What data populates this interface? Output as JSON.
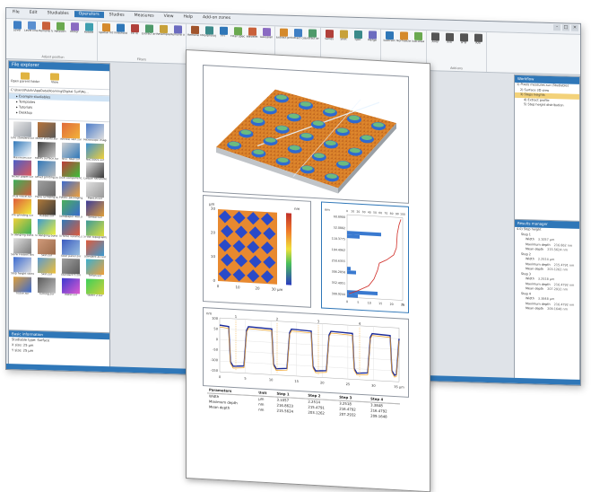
{
  "window": {
    "tabs": [
      "File",
      "Edit",
      "Studiables",
      "Operators",
      "Studies",
      "Measures",
      "View",
      "Help",
      "Add-on zones"
    ],
    "active_tab": "Operators"
  },
  "ribbon": {
    "groups": [
      {
        "label": "Adjust position",
        "buttons": [
          {
            "label": "Level",
            "color": "#3f7fc4"
          },
          {
            "label": "Level line-by-line",
            "color": "#5a8fd0"
          },
          {
            "label": "Remove form",
            "color": "#c9603a"
          },
          {
            "label": "Retouch",
            "color": "#6aa94f"
          },
          {
            "label": "Mirror",
            "color": "#8a6bc2"
          },
          {
            "label": "Rotate",
            "color": "#3f9fb0"
          }
        ]
      },
      {
        "label": "Filters",
        "buttons": [
          {
            "label": "Spatial filter",
            "color": "#d58a2c"
          },
          {
            "label": "Threshold",
            "color": "#2f77b8"
          },
          {
            "label": "Fill in",
            "color": "#b0403a"
          },
          {
            "label": "Extract area",
            "color": "#4e9a6a"
          },
          {
            "label": "Resample",
            "color": "#c7a13a"
          },
          {
            "label": "Remove outliers",
            "color": "#6c6cc0"
          }
        ]
      },
      {
        "label": "Filter",
        "buttons": [
          {
            "label": "Remove noise",
            "color": "#a0542c"
          },
          {
            "label": "Morphologic",
            "color": "#3a8a8a"
          },
          {
            "label": "FFT",
            "color": "#2f77b8"
          },
          {
            "label": "Filter spectrum",
            "color": "#6aa94f"
          },
          {
            "label": "Wavelet",
            "color": "#c9603a"
          },
          {
            "label": "Gaussian",
            "color": "#8a6bc2"
          }
        ]
      },
      {
        "label": "Extract",
        "buttons": [
          {
            "label": "Extract profile",
            "color": "#d58a2c"
          },
          {
            "label": "Extract contour",
            "color": "#3f7fc4"
          },
          {
            "label": "Extract area",
            "color": "#4e9a6a"
          }
        ]
      },
      {
        "label": "Combine",
        "buttons": [
          {
            "label": "Series",
            "color": "#b0403a"
          },
          {
            "label": "Shift",
            "color": "#c7a13a"
          },
          {
            "label": "Split",
            "color": "#3a8a8a"
          },
          {
            "label": "Merge",
            "color": "#6c6cc0"
          }
        ]
      },
      {
        "label": "Studies",
        "buttons": [
          {
            "label": "Subtract",
            "color": "#2f77b8"
          },
          {
            "label": "Normalize",
            "color": "#d58a2c"
          },
          {
            "label": "Sub-area",
            "color": "#6aa94f"
          }
        ]
      },
      {
        "label": "Add-ons",
        "buttons": [
          {
            "label": "A+B",
            "color": "#555555"
          },
          {
            "label": "A-B",
            "color": "#555555"
          },
          {
            "label": "A*B",
            "color": "#555555"
          },
          {
            "label": "A/B",
            "color": "#555555"
          }
        ]
      }
    ]
  },
  "left_panel": {
    "title": "File explorer",
    "toolbar": [
      {
        "label": "Open parent folder"
      },
      {
        "label": "View"
      }
    ],
    "path": "C:\\Users\\Public\\AppData\\Roaming\\Digital Surf\\Mo...",
    "tree": [
      "Example studiables",
      "Templates",
      "Tutorials",
      "Desktop"
    ],
    "tree_selected": 0,
    "thumbnails": [
      {
        "label": "Line standard.sur",
        "a": "#e9e9e9",
        "b": "#9aa0a8"
      },
      {
        "label": "Metal inserts.sur",
        "a": "#b8743a",
        "b": "#5a5a5a"
      },
      {
        "label": "Wrinkle skin.sur",
        "a": "#e06a3a",
        "b": "#f2b33a"
      },
      {
        "label": "Microscope image.sur",
        "a": "#4a7ac8",
        "b": "#e0e0e0"
      },
      {
        "label": "Maximum.sur",
        "a": "#2f77b8",
        "b": "#ffffff"
      },
      {
        "label": "MEMS surface.sur",
        "a": "#3b3b3b",
        "b": "#cfcfcf"
      },
      {
        "label": "NIST fiber.sur",
        "a": "#d0d0d0",
        "b": "#2f77b8"
      },
      {
        "label": "NaCl0001.sur",
        "a": "#3a8fd0",
        "b": "#f0d03a"
      },
      {
        "label": "Nickel paper.sur",
        "a": "#4a5ec8",
        "b": "#e05a5a"
      },
      {
        "label": "Offset printing.sur",
        "a": "#2f77b8",
        "b": "#c0c0c0"
      },
      {
        "label": "Dual component.sur",
        "a": "#c03a3a",
        "b": "#3ac03a"
      },
      {
        "label": "Carbon nanotube.sur",
        "a": "#e0e0e0",
        "b": "#3a3a3a"
      },
      {
        "label": "PCB visual.sur",
        "a": "#3ab05a",
        "b": "#d05a3a"
      },
      {
        "label": "Plane Grinding.sur",
        "a": "#a0a0a0",
        "b": "#6a6a6a"
      },
      {
        "label": "Plastic packaging.sur",
        "a": "#3a6ad0",
        "b": "#f0a03a"
      },
      {
        "label": "PlanLin.sur",
        "a": "#e0e0e0",
        "b": "#9a9a9a"
      },
      {
        "label": "Pre-grinding.sur",
        "a": "#e05a3a",
        "b": "#f0f03a"
      },
      {
        "label": "Rubber.sur",
        "a": "#b07a3a",
        "b": "#3a3a3a"
      },
      {
        "label": "Sandpaper 400.sur",
        "a": "#4ab05a",
        "b": "#3a6ad0"
      },
      {
        "label": "Sensor.sur",
        "a": "#3a3a9a",
        "b": "#e0a03a"
      },
      {
        "label": "Si dangling bond.sur",
        "a": "#f0d03a",
        "b": "#3ab05a"
      },
      {
        "label": "Si dangling bond 2.sur",
        "a": "#3a9ad0",
        "b": "#f0f03a"
      },
      {
        "label": "Si force volume.sur",
        "a": "#2f77b8",
        "b": "#e05a3a"
      },
      {
        "label": "Si-dot topography.sur",
        "a": "#3a9a9a",
        "b": "#e0e03a"
      },
      {
        "label": "Slenk Fresnel lens.sur",
        "a": "#e0e0e0",
        "b": "#7a7a7a"
      },
      {
        "label": "Skin.sur",
        "a": "#d09a7a",
        "b": "#9a6a4a"
      },
      {
        "label": "Solar panel.sur",
        "a": "#3a5ac0",
        "b": "#9ac0e0"
      },
      {
        "label": "Standard 2D.sur",
        "a": "#e05a3a",
        "b": "#3a9ad0"
      },
      {
        "label": "Step height standard.sur",
        "a": "#3a6ad0",
        "b": "#e0e0e0"
      },
      {
        "label": "Skin.sur",
        "a": "#5a9ad0",
        "b": "#f0c03a"
      },
      {
        "label": "Standard 5.sur",
        "a": "#a0a0a0",
        "b": "#5a5a5a"
      },
      {
        "label": "Teflon.sur",
        "a": "#3ab0d0",
        "b": "#f0a03a"
      },
      {
        "label": "Tissue.sur",
        "a": "#e0a03a",
        "b": "#3a6ad0"
      },
      {
        "label": "Turning.sur",
        "a": "#5a5a5a",
        "b": "#c0c0c0"
      },
      {
        "label": "Wafer.sur",
        "a": "#3a3ad0",
        "b": "#e05ad0"
      },
      {
        "label": "Wafer 2.sur",
        "a": "#3ad05a",
        "b": "#d0d03a"
      }
    ],
    "basic_info": {
      "title": "Basic information",
      "lines": [
        "Studiable type: Surface",
        "X size: 25 µm",
        "Y size: 25 µm"
      ]
    }
  },
  "right_panel": {
    "top_title": "Workflow",
    "top_rows": [
      {
        "text": "1) Pixels measures.sur (Studiable)",
        "indent": 2,
        "sel": false
      },
      {
        "text": "2) Surface 3D view",
        "indent": 6,
        "sel": false
      },
      {
        "text": "3) Steps heights",
        "indent": 6,
        "sel": true
      },
      {
        "text": "4) Extract profile",
        "indent": 10,
        "sel": false
      },
      {
        "text": "5) Step height distribution",
        "indent": 10,
        "sel": false
      }
    ],
    "bottom_title": "Results manager",
    "bottom_rows": [
      {
        "text": "4.0) Step height",
        "v": ""
      },
      {
        "text": "Step 1",
        "v": ""
      },
      {
        "text": "Width",
        "v": "3.1057 µm"
      },
      {
        "text": "Maximum depth",
        "v": "216.862 nm"
      },
      {
        "text": "Mean depth",
        "v": "215.5624 nm"
      },
      {
        "text": "Step 2",
        "v": ""
      },
      {
        "text": "Width",
        "v": "2.2514 µm"
      },
      {
        "text": "Maximum depth",
        "v": "215.4791 nm"
      },
      {
        "text": "Mean depth",
        "v": "203.1262 nm"
      },
      {
        "text": "Step 3",
        "v": ""
      },
      {
        "text": "Width",
        "v": "3.2518 µm"
      },
      {
        "text": "Maximum depth",
        "v": "216.4792 nm"
      },
      {
        "text": "Mean depth",
        "v": "207.2932 nm"
      },
      {
        "text": "Step 4",
        "v": ""
      },
      {
        "text": "Width",
        "v": "3.3848 µm"
      },
      {
        "text": "Maximum depth",
        "v": "216.4792 nm"
      },
      {
        "text": "Mean depth",
        "v": "209.1648 nm"
      }
    ]
  },
  "status": {
    "text": "Ready"
  },
  "report": {
    "colormap": {
      "y_unit": "µm",
      "x_unit": "µm",
      "scale_unit": "nm",
      "x_ticks": [
        "0",
        "10",
        "20",
        "30 µm"
      ],
      "y_ticks": [
        "0",
        "10",
        "20",
        "30"
      ],
      "scale_ticks": [
        "",
        "",
        "",
        "",
        "",
        ""
      ]
    },
    "histogram": {
      "top_ticks": [
        "0",
        "10",
        "20",
        "30",
        "40",
        "50",
        "60",
        "70",
        "80",
        "90",
        "100"
      ],
      "top_unit": "%",
      "y_unit": "nm",
      "y_labels": [
        "60.8900",
        "52.0882",
        "118.3775",
        "184.4962",
        "250.6355",
        "306.2858",
        "352.4951",
        "399.9244"
      ],
      "bottom_ticks": [
        "0",
        "5",
        "10",
        "15",
        "20",
        "25"
      ],
      "bottom_unit": "%"
    },
    "profile": {
      "y_unit": "nm",
      "y_ticks": [
        "100",
        "50",
        "0",
        "-50",
        "-100",
        "-150"
      ],
      "x_ticks": [
        "0",
        "5",
        "10",
        "15",
        "20",
        "25",
        "30",
        "35 µm"
      ],
      "step_markers": [
        "1",
        "2",
        "3",
        "4"
      ]
    },
    "table": {
      "headers": [
        "Parameters",
        "Unit",
        "Step 1",
        "Step 2",
        "Step 3",
        "Step 4"
      ],
      "rows": [
        [
          "Width",
          "µm",
          "3.1057",
          "2.2514",
          "3.2518",
          "3.3848"
        ],
        [
          "Maximum depth",
          "nm",
          "216.8623",
          "215.4791",
          "216.4792",
          "216.4792"
        ],
        [
          "Mean depth",
          "nm",
          "215.5624",
          "203.1262",
          "207.2932",
          "209.1648"
        ]
      ]
    }
  }
}
